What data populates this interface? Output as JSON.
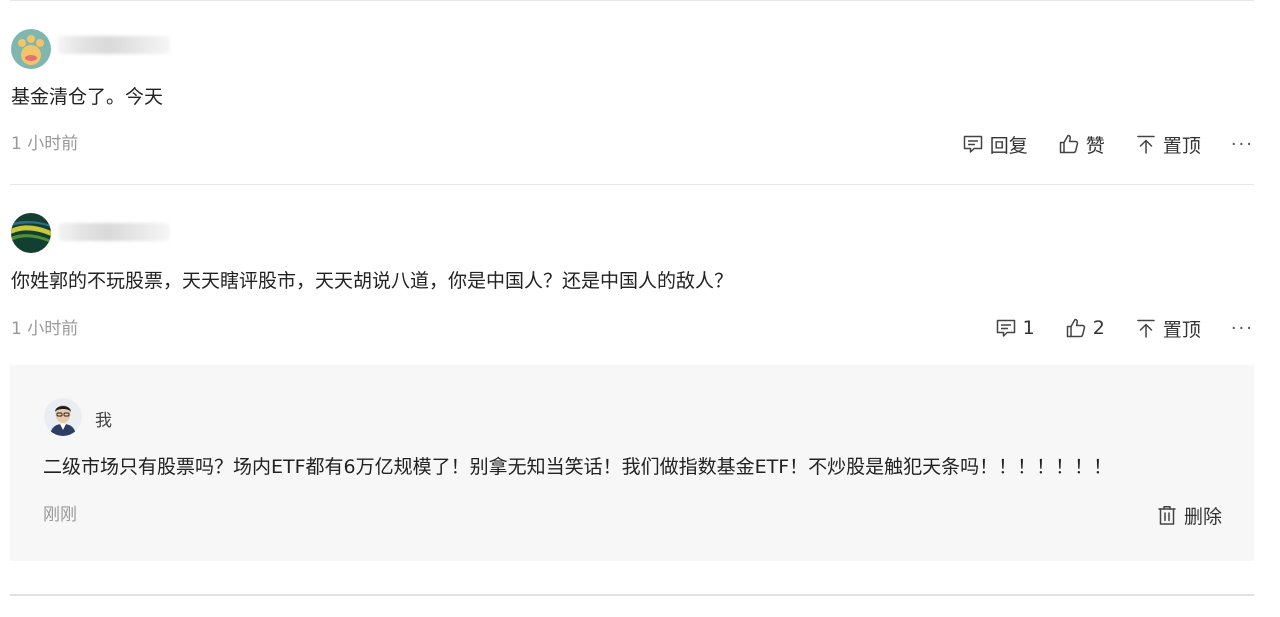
{
  "comments": [
    {
      "text": "基金清仓了。今天",
      "time": "1 小时前",
      "reply_label": "回复",
      "like_label": "赞",
      "pin_label": "置顶",
      "more_label": "···"
    },
    {
      "text": "你姓郭的不玩股票，天天瞎评股市，天天胡说八道，你是中国人？还是中国人的敌人？",
      "time": "1 小时前",
      "reply_count": "1",
      "like_count": "2",
      "pin_label": "置顶",
      "more_label": "···"
    }
  ],
  "my_reply": {
    "author": "我",
    "text": "二级市场只有股票吗？场内ETF都有6万亿规模了！别拿无知当笑话！我们做指数基金ETF！不炒股是触犯天条吗！！！！！！！",
    "time": "刚刚",
    "delete_label": "删除"
  },
  "icons": {
    "reply": "comment-bubble-icon",
    "like": "thumbs-up-icon",
    "pin": "pin-to-top-icon",
    "delete": "trash-icon"
  },
  "colors": {
    "text": "#222222",
    "muted": "#999999",
    "divider": "#e8e8e8",
    "reply_bg": "#f7f7f7"
  }
}
